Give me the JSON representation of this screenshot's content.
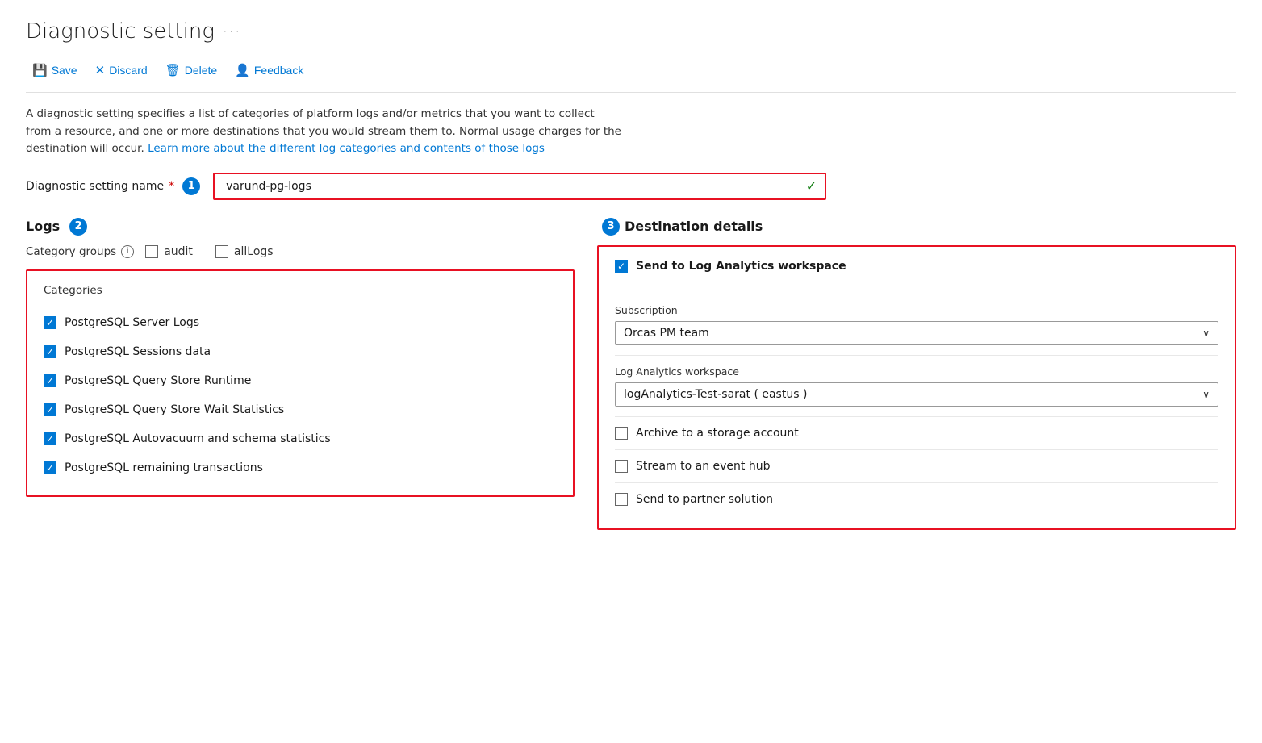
{
  "page": {
    "title": "Diagnostic setting",
    "title_dots": "···"
  },
  "toolbar": {
    "save": "Save",
    "discard": "Discard",
    "delete": "Delete",
    "feedback": "Feedback"
  },
  "description": {
    "text1": "A diagnostic setting specifies a list of categories of platform logs and/or metrics that you want to collect from a resource, and one or more destinations that you would stream them to. Normal usage charges for the destination will occur.",
    "link_text": "Learn more about the different log categories and contents of those logs"
  },
  "name_field": {
    "label": "Diagnostic setting name",
    "step": "1",
    "required": "*",
    "value": "varund-pg-logs"
  },
  "logs": {
    "title": "Logs",
    "step": "2",
    "category_groups_label": "Category groups",
    "audit_label": "audit",
    "all_logs_label": "allLogs",
    "categories_title": "Categories",
    "items": [
      {
        "label": "PostgreSQL Server Logs",
        "checked": true
      },
      {
        "label": "PostgreSQL Sessions data",
        "checked": true
      },
      {
        "label": "PostgreSQL Query Store Runtime",
        "checked": true
      },
      {
        "label": "PostgreSQL Query Store Wait Statistics",
        "checked": true
      },
      {
        "label": "PostgreSQL Autovacuum and schema statistics",
        "checked": true
      },
      {
        "label": "PostgreSQL remaining transactions",
        "checked": true
      }
    ]
  },
  "destination": {
    "title": "Destination details",
    "step": "3",
    "send_to_log_analytics": "Send to Log Analytics workspace",
    "send_to_log_analytics_checked": true,
    "subscription_label": "Subscription",
    "subscription_value": "Orcas PM team",
    "log_analytics_label": "Log Analytics workspace",
    "log_analytics_value": "logAnalytics-Test-sarat ( eastus )",
    "archive_label": "Archive to a storage account",
    "archive_checked": false,
    "stream_label": "Stream to an event hub",
    "stream_checked": false,
    "partner_label": "Send to partner solution",
    "partner_checked": false
  }
}
